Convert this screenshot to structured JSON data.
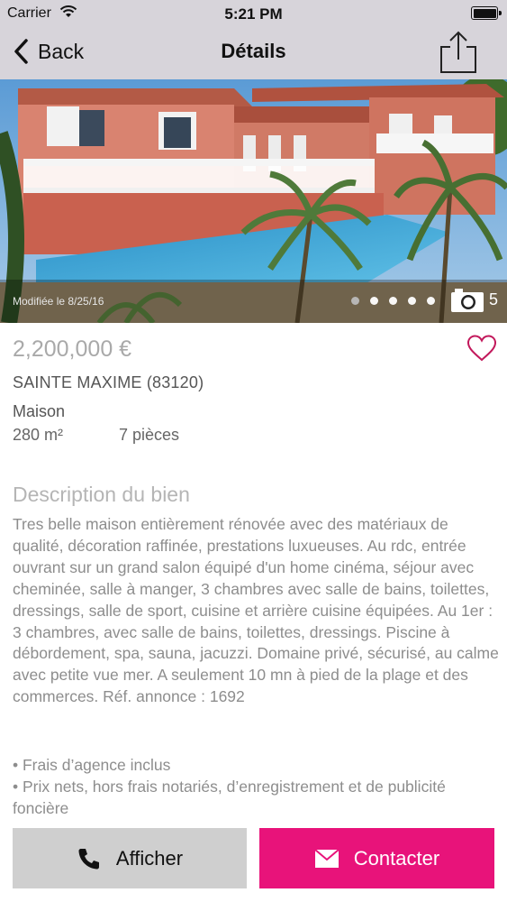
{
  "status_bar": {
    "carrier": "Carrier",
    "time": "5:21 PM"
  },
  "nav": {
    "back_label": "Back",
    "title": "Détails",
    "share_icon": "share-icon"
  },
  "gallery": {
    "modified_text": "Modifiée le 8/25/16",
    "photo_count": "5",
    "active_photo_index": 0,
    "total_dots": 5,
    "camera_icon": "camera-icon"
  },
  "listing": {
    "price": "2,200,000 €",
    "city": "SAINTE MAXIME (83120)",
    "type": "Maison",
    "surface": "280 m²",
    "rooms": "7 pièces",
    "favorite_icon": "heart-outline-icon"
  },
  "description": {
    "title": "Description du bien",
    "text": "Tres belle maison entièrement rénovée avec des matériaux de qualité, décoration raffinée, prestations luxueuses. Au rdc, entrée ouvrant sur un grand salon équipé d'un home cinéma, séjour avec cheminée, salle à manger, 3 chambres avec salle de bains, toilettes, dressings, salle de sport, cuisine et arrière cuisine équipées. Au 1er : 3 chambres, avec salle de bains, toilettes, dressings. Piscine à débordement, spa, sauna, jacuzzi. Domaine privé, sécurisé, au calme avec petite vue mer. A seulement 10 mn à pied de la plage et des commerces. Réf. annonce : 1692",
    "bullets": [
      "• Frais d’agence inclus",
      "• Prix nets, hors frais notariés, d’enregistrement et de publicité foncière"
    ]
  },
  "actions": {
    "show_label": "Afficher",
    "contact_label": "Contacter"
  },
  "colors": {
    "accent": "#e8137a",
    "heart": "#c2185b",
    "header_bg": "#d7d4da"
  }
}
